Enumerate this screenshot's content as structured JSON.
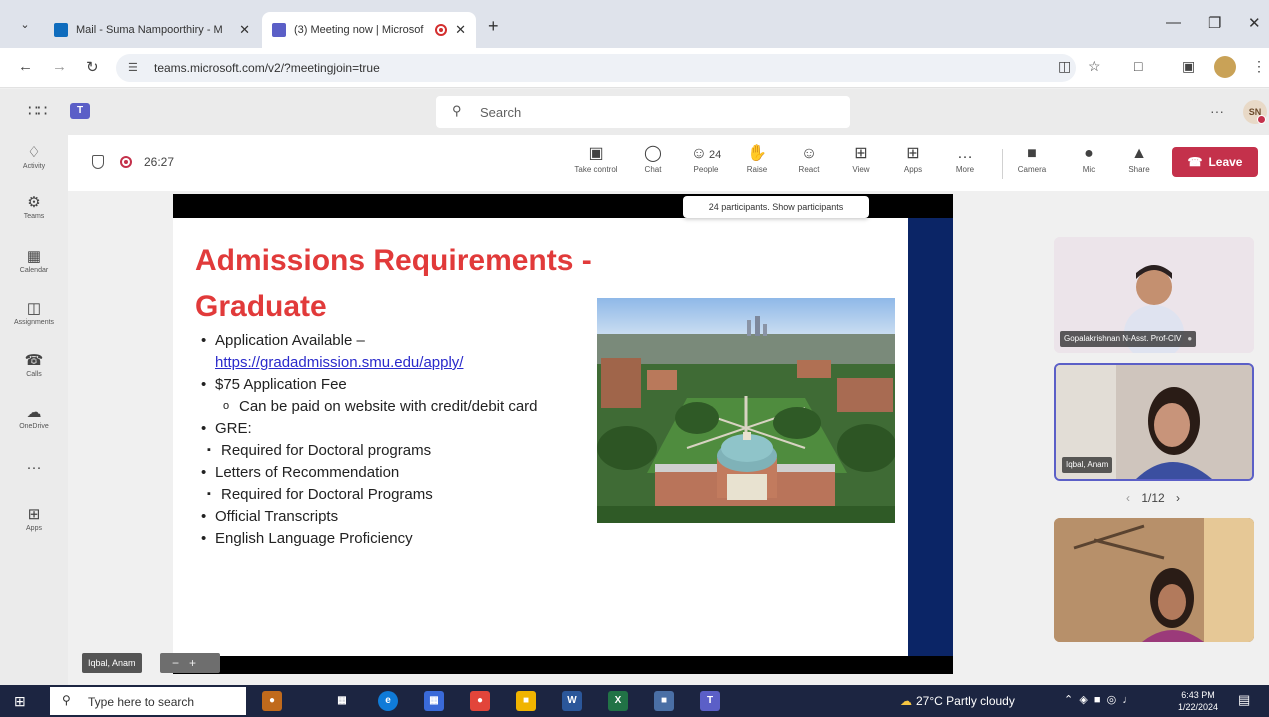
{
  "browser": {
    "tabs": [
      {
        "title": "Mail - Suma Nampoorthiry - M",
        "favicon": "outlook-icon",
        "active": false
      },
      {
        "title": "(3) Meeting now | Microsof",
        "favicon": "teams-icon",
        "active": true
      }
    ],
    "url": "teams.microsoft.com/v2/?meetingjoin=true"
  },
  "teams": {
    "search_placeholder": "Search",
    "more": "···",
    "user_initials": "SN"
  },
  "rail": [
    {
      "label": "Activity",
      "icon": "bell-icon"
    },
    {
      "label": "Teams",
      "icon": "teams-people-icon"
    },
    {
      "label": "Calendar",
      "icon": "calendar-icon"
    },
    {
      "label": "Assignments",
      "icon": "backpack-icon"
    },
    {
      "label": "Calls",
      "icon": "phone-icon"
    },
    {
      "label": "OneDrive",
      "icon": "cloud-icon"
    },
    {
      "label": "···",
      "icon": "more-icon"
    },
    {
      "label": "Apps",
      "icon": "apps-plus-icon"
    }
  ],
  "meeting": {
    "timer": "26:27",
    "toolbar": [
      {
        "label": "Take control"
      },
      {
        "label": "Chat"
      },
      {
        "label": "People",
        "count": "24"
      },
      {
        "label": "Raise"
      },
      {
        "label": "React"
      },
      {
        "label": "View"
      },
      {
        "label": "Apps"
      },
      {
        "label": "More"
      },
      {
        "label": "Camera"
      },
      {
        "label": "Mic"
      },
      {
        "label": "Share"
      }
    ],
    "leave": "Leave",
    "tooltip": "24 participants. Show participants"
  },
  "slide": {
    "title_line1": "Admissions Requirements -",
    "title_line2": "Graduate",
    "bullets": [
      {
        "text": "Application Available –",
        "level": 1,
        "marker": "•"
      },
      {
        "text": "https://gradadmission.smu.edu/apply/",
        "level": 1,
        "link": true,
        "marker": ""
      },
      {
        "text": "$75 Application Fee",
        "level": 1,
        "marker": "•"
      },
      {
        "text": "Can be paid on website with credit/debit card",
        "level": 2,
        "marker": "o"
      },
      {
        "text": "GRE:",
        "level": 1,
        "marker": "•"
      },
      {
        "text": "Required for Doctoral programs",
        "level": 2,
        "marker": "▪"
      },
      {
        "text": "Letters of Recommendation",
        "level": 1,
        "marker": "•"
      },
      {
        "text": "Required for Doctoral Programs",
        "level": 2,
        "marker": "▪"
      },
      {
        "text": "Official Transcripts",
        "level": 1,
        "marker": "•"
      },
      {
        "text": "English Language Proficiency",
        "level": 1,
        "marker": "•"
      }
    ],
    "colors": {
      "title": "#e13a3a",
      "sidebar": "#0b2566"
    }
  },
  "participants": [
    {
      "name": "Gopalakrishnan N-Asst. Prof-CIV",
      "muted": true
    },
    {
      "name": "Iqbal, Anam",
      "muted": false,
      "active_speaker": true
    },
    {
      "name": "",
      "muted": false
    }
  ],
  "pager": {
    "text": "1/12"
  },
  "speaker_chip": "Iqbal, Anam",
  "taskbar": {
    "search_placeholder": "Type here to search",
    "weather": "27°C  Partly cloudy",
    "time": "6:43 PM",
    "date": "1/22/2024"
  }
}
